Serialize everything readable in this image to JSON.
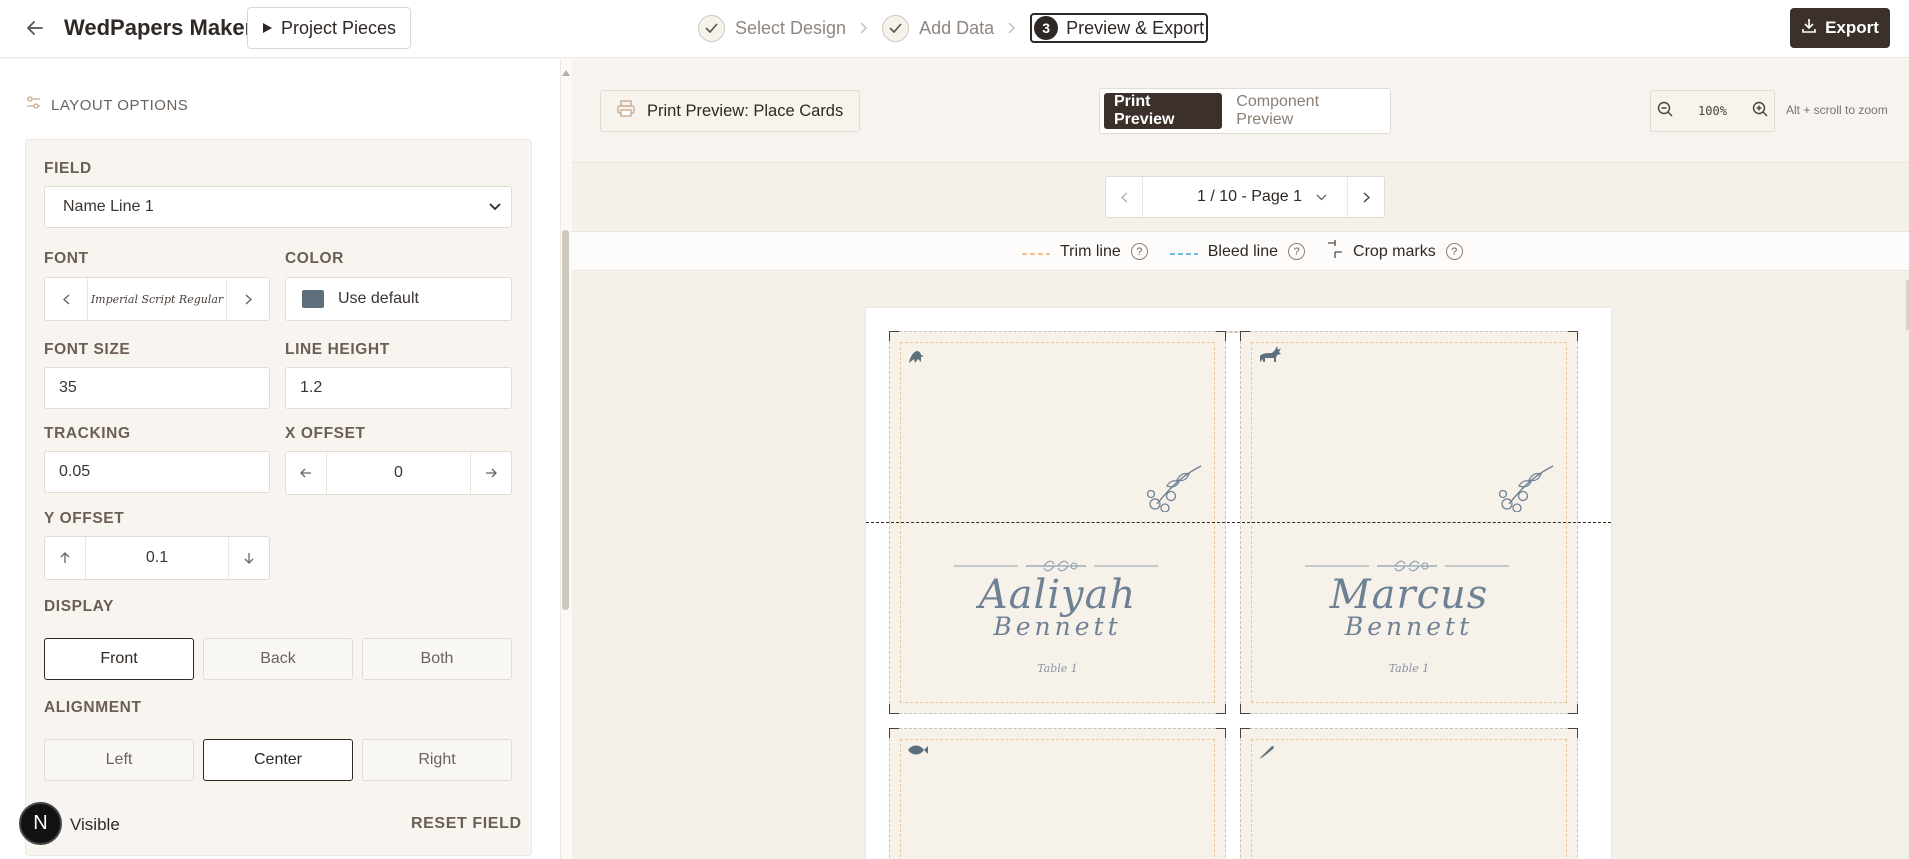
{
  "header": {
    "app_title": "WedPapers Maker",
    "project_pieces_label": "Project Pieces",
    "steps": [
      {
        "label": "Select Design"
      },
      {
        "label": "Add Data"
      },
      {
        "label": "Preview & Export",
        "number": "3"
      }
    ],
    "export_label": "Export"
  },
  "sidebar": {
    "section_title": "LAYOUT OPTIONS",
    "field_label": "FIELD",
    "field_value": "Name Line 1",
    "font_label": "FONT",
    "font_value": "Imperial Script Regular",
    "color_label": "COLOR",
    "color_value": "Use default",
    "color_swatch": "#5e6f7c",
    "font_size_label": "FONT SIZE",
    "font_size_value": "35",
    "line_height_label": "LINE HEIGHT",
    "line_height_value": "1.2",
    "tracking_label": "TRACKING",
    "tracking_value": "0.05",
    "x_offset_label": "X OFFSET",
    "x_offset_value": "0",
    "y_offset_label": "Y OFFSET",
    "y_offset_value": "0.1",
    "display_label": "DISPLAY",
    "display_options": [
      "Front",
      "Back",
      "Both"
    ],
    "display_selected": "Front",
    "alignment_label": "ALIGNMENT",
    "alignment_options": [
      "Left",
      "Center",
      "Right"
    ],
    "alignment_selected": "Center",
    "visible_label": "Visible",
    "reset_label": "RESET FIELD",
    "badge_letter": "N"
  },
  "preview": {
    "title": "Print Preview: Place Cards",
    "view_tabs": [
      "Print Preview",
      "Component Preview"
    ],
    "view_selected": "Print Preview",
    "zoom_value": "100%",
    "zoom_hint": "Alt + scroll to zoom",
    "page_label": "1 / 10 - Page 1",
    "legend": {
      "trim": "Trim line",
      "bleed": "Bleed line",
      "crop": "Crop marks",
      "help": "?"
    },
    "cards": [
      {
        "first": "Aaliyah",
        "last": "Bennett",
        "table": "Table 1",
        "icon": "bird-icon"
      },
      {
        "first": "Marcus",
        "last": "Bennett",
        "table": "Table 1",
        "icon": "deer-icon"
      },
      {
        "icon": "fish-icon"
      },
      {
        "icon": "feather-icon"
      }
    ]
  },
  "colors": {
    "accent_dark": "#3b302a",
    "name_ink": "#6f8194",
    "card_bg": "#f6f2e9",
    "trim_line": "#e9c79c",
    "bleed_line": "#3fa6d8"
  }
}
